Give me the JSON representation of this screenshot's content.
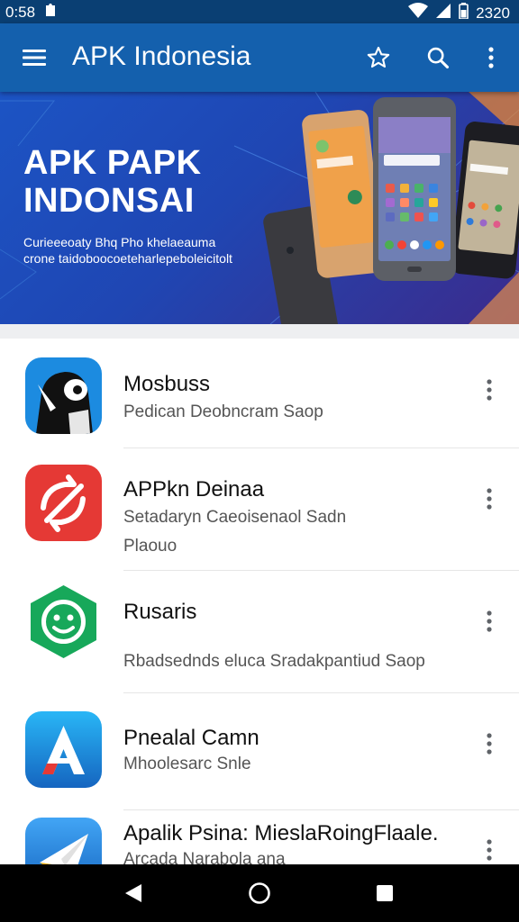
{
  "status_bar": {
    "time": "0:58",
    "right_text": "2320"
  },
  "app_bar": {
    "title": "APK Indonesia"
  },
  "banner": {
    "headline_line1": "APK PAPK",
    "headline_line2": "INDONSAI",
    "sub_line1": "Curieeeoaty Bhq Pho khelaeauma",
    "sub_line2": "crone taidoboocoeteharlepeboleicitolt"
  },
  "apps": [
    {
      "name": "Mosbuss",
      "desc": "Pedican Deobncram Saop",
      "desc2": "",
      "icon": "penguin-app-icon",
      "color": "#1c8be0"
    },
    {
      "name": "APPkn Deinaa",
      "desc": "Setadaryn Caeoisenaol Sadn",
      "desc2": "Plaouo",
      "icon": "refresh-arrows-app-icon",
      "color": "#e53935"
    },
    {
      "name": "Rusaris",
      "desc": "Rbadsednds eluca Sradakpantiud Saop",
      "desc2": "",
      "icon": "smile-gear-app-icon",
      "color": "#17a85a"
    },
    {
      "name": "Pnealal Camn",
      "desc": "Mhoolesarc Snle",
      "desc2": "",
      "icon": "letter-a-app-icon",
      "color": "#1e88e5"
    },
    {
      "name": "Apalik Psina: MieslaRoingFlaale.",
      "desc": "Arcada Narabola ana",
      "desc2": "",
      "icon": "paper-plane-app-icon",
      "color": "#1e88e5"
    }
  ]
}
